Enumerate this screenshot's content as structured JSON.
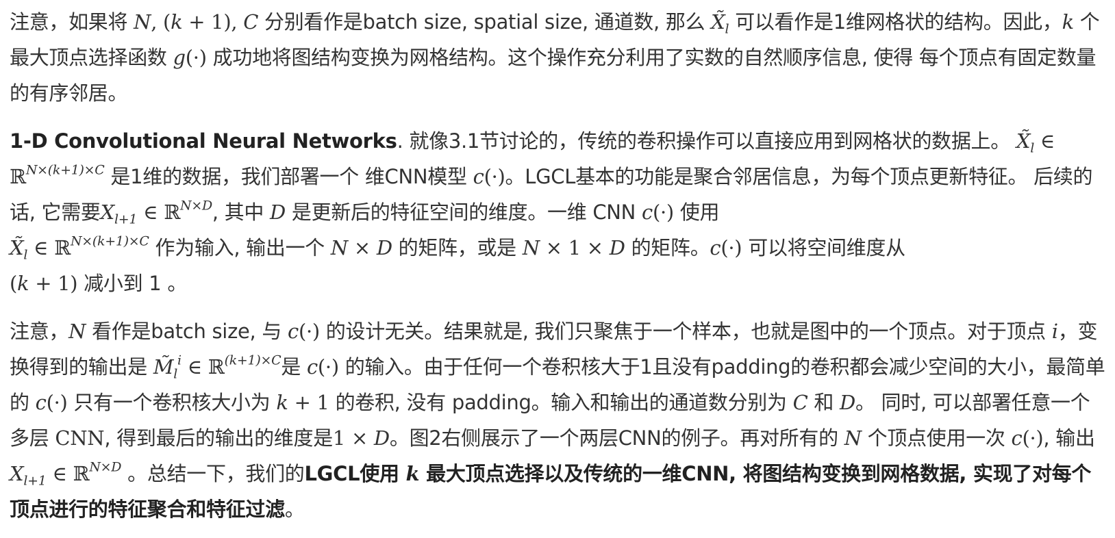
{
  "paragraphs": [
    {
      "runs": [
        {
          "t": "注意，如果将 "
        },
        {
          "t": "N",
          "m": 1
        },
        {
          "t": ", (",
          "mr": 1
        },
        {
          "t": "k",
          "m": 1
        },
        {
          "t": " + 1), ",
          "mr": 1
        },
        {
          "t": "C",
          "m": 1
        },
        {
          "t": " 分别看作是batch size, spatial size, 通道数, 那么 "
        },
        {
          "t": "X̃",
          "m": 1
        },
        {
          "t": "l",
          "m": 1,
          "sub": 1
        },
        {
          "t": " 可以看作是1维网格状的结构。因此，"
        },
        {
          "t": "k",
          "m": 1
        },
        {
          "t": " 个最大顶点选择函数 "
        },
        {
          "t": "g",
          "m": 1
        },
        {
          "t": "(·)",
          "mr": 1
        },
        {
          "t": " 成功地将图结构变换为网格结构。这个操作充分利用了实数的自然顺序信息, 使得 每个顶点有固定数量的有序邻居。"
        }
      ]
    },
    {
      "runs": [
        {
          "t": "1-D Convolutional Neural Networks",
          "b": 1
        },
        {
          "t": ". 就像3.1节讨论的，传统的卷积操作可以直接应用到网格状的数据上。 "
        },
        {
          "t": "X̃",
          "m": 1
        },
        {
          "t": "l",
          "m": 1,
          "sub": 1
        },
        {
          "t": " ∈ ℝ",
          "mr": 1
        },
        {
          "t": "N×(k+1)×C",
          "m": 1,
          "sup": 1
        },
        {
          "t": " 是1维的数据，我们部署一个 维CNN模型 "
        },
        {
          "t": "c",
          "m": 1
        },
        {
          "t": "(·)",
          "mr": 1
        },
        {
          "t": "。LGCL基本的功能是聚合邻居信息，为每个顶点更新特征。 后续的话, 它需要"
        },
        {
          "t": "X",
          "m": 1
        },
        {
          "t": "l+1",
          "m": 1,
          "sub": 1
        },
        {
          "t": " ∈ ℝ",
          "mr": 1
        },
        {
          "t": "N×D",
          "m": 1,
          "sup": 1
        },
        {
          "t": ", 其中 "
        },
        {
          "t": "D",
          "m": 1
        },
        {
          "t": " 是更新后的特征空间的维度。一维 CNN "
        },
        {
          "t": "c",
          "m": 1
        },
        {
          "t": "(·)",
          "mr": 1
        },
        {
          "t": " 使用",
          "br": 1
        },
        {
          "t": "X̃",
          "m": 1
        },
        {
          "t": "l",
          "m": 1,
          "sub": 1
        },
        {
          "t": " ∈ ℝ",
          "mr": 1
        },
        {
          "t": "N×(k+1)×C",
          "m": 1,
          "sup": 1
        },
        {
          "t": " 作为输入, 输出一个 "
        },
        {
          "t": "N",
          "m": 1
        },
        {
          "t": " × ",
          "mr": 1
        },
        {
          "t": "D",
          "m": 1
        },
        {
          "t": "  的矩阵，或是 "
        },
        {
          "t": "N",
          "m": 1
        },
        {
          "t": " × 1 × ",
          "mr": 1
        },
        {
          "t": "D",
          "m": 1
        },
        {
          "t": " 的矩阵。"
        },
        {
          "t": "c",
          "m": 1
        },
        {
          "t": "(·)",
          "mr": 1
        },
        {
          "t": " 可以将空间维度从",
          "br": 1
        },
        {
          "t": "(",
          "mr": 1
        },
        {
          "t": "k",
          "m": 1
        },
        {
          "t": " + 1)",
          "mr": 1
        },
        {
          "t": " 减小到 1 。"
        }
      ]
    },
    {
      "runs": [
        {
          "t": " 注意，"
        },
        {
          "t": "N",
          "m": 1
        },
        {
          "t": " 看作是batch size, 与 "
        },
        {
          "t": "c",
          "m": 1
        },
        {
          "t": "(·)",
          "mr": 1
        },
        {
          "t": " 的设计无关。结果就是, 我们只聚焦于一个样本，也就是图中的一个顶点。对于顶点 "
        },
        {
          "t": "i",
          "m": 1
        },
        {
          "t": "，变换得到的输出是 "
        },
        {
          "t": "M̃",
          "m": 1
        },
        {
          "t": "l",
          "m": 1,
          "sub": 1
        },
        {
          "t": "i",
          "m": 1,
          "sup": 1
        },
        {
          "t": " ∈ ℝ",
          "mr": 1
        },
        {
          "t": "(k+1)×C",
          "m": 1,
          "sup": 1
        },
        {
          "t": "是 "
        },
        {
          "t": "c",
          "m": 1
        },
        {
          "t": "(·)",
          "mr": 1
        },
        {
          "t": " 的输入。由于任何一个卷积核大于1且没有padding的卷积都会减少空间的大小，最简单的 "
        },
        {
          "t": "c",
          "m": 1
        },
        {
          "t": "(·)",
          "mr": 1
        },
        {
          "t": " 只有一个卷积核大小为 "
        },
        {
          "t": "k",
          "m": 1
        },
        {
          "t": " + 1",
          "mr": 1
        },
        {
          "t": " 的卷积, 没有 padding。输入和输出的通道数分别为 "
        },
        {
          "t": "C",
          "m": 1
        },
        {
          "t": " 和 "
        },
        {
          "t": "D",
          "m": 1
        },
        {
          "t": "。 同时, 可以部署任意一个多层 "
        },
        {
          "t": "CNN",
          "mr": 1
        },
        {
          "t": ", 得到最后的输出的维度是"
        },
        {
          "t": "1 × ",
          "mr": 1
        },
        {
          "t": "D",
          "m": 1
        },
        {
          "t": "。图2右侧展示了一个两层CNN的例子。再对所有的 "
        },
        {
          "t": "N",
          "m": 1
        },
        {
          "t": " 个顶点使用一次 "
        },
        {
          "t": "c",
          "m": 1
        },
        {
          "t": "(·)",
          "mr": 1
        },
        {
          "t": ", 输出"
        },
        {
          "t": "X",
          "m": 1
        },
        {
          "t": "l+1",
          "m": 1,
          "sub": 1
        },
        {
          "t": " ∈ ℝ",
          "mr": 1
        },
        {
          "t": "N×D",
          "m": 1,
          "sup": 1
        },
        {
          "t": " 。总结一下，我们的"
        },
        {
          "t": "LGCL使用 ",
          "b": 1
        },
        {
          "t": "k",
          "m": 1,
          "b": 1
        },
        {
          "t": " 最大顶点选择以及传统的一维CNN, 将图结构变换到网格数据, 实现了对每个顶点进行的特征聚合和特征过滤",
          "b": 1
        },
        {
          "t": "。"
        }
      ]
    }
  ]
}
